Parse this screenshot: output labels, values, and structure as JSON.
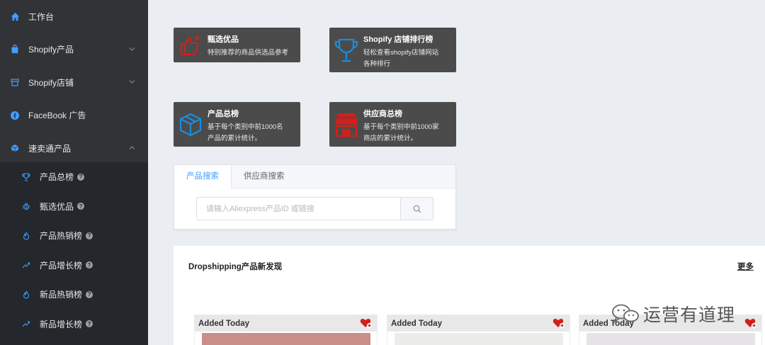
{
  "sidebar": {
    "items": [
      {
        "label": "工作台",
        "icon": "home-icon"
      },
      {
        "label": "Shopify产品",
        "icon": "bag-icon"
      },
      {
        "label": "Shopify店铺",
        "icon": "store-icon"
      },
      {
        "label": "FaceBook 广告",
        "icon": "facebook-icon"
      },
      {
        "label": "速卖通产品",
        "icon": "box-icon"
      }
    ],
    "submenu": [
      {
        "label": "产品总榜",
        "icon": "trophy-icon"
      },
      {
        "label": "甄选优品",
        "icon": "bug-icon"
      },
      {
        "label": "产品热销榜",
        "icon": "fire-icon"
      },
      {
        "label": "产品增长榜",
        "icon": "trend-icon"
      },
      {
        "label": "新品热销榜",
        "icon": "fire-icon"
      },
      {
        "label": "新品增长榜",
        "icon": "trend-icon"
      }
    ]
  },
  "cards": [
    {
      "title": "甄选优品",
      "desc1": "特别推荐的商品供选品参考",
      "desc2": "",
      "icon": "thumbs-up-icon",
      "color": "#d0201c"
    },
    {
      "title": "Shopify 店铺排行榜",
      "desc1": "轻松查看shopify店铺网站",
      "desc2": "各种排行",
      "icon": "trophy-icon",
      "color": "#1a8ddd"
    },
    {
      "title": "产品总榜",
      "desc1": "基于每个类别中前1000名",
      "desc2": "产品的累计统计。",
      "icon": "cube-icon",
      "color": "#1a8ddd"
    },
    {
      "title": "供应商总榜",
      "desc1": "基于每个类别中前1000家",
      "desc2": "商店的累计统计。",
      "icon": "shop-icon",
      "color": "#d0201c"
    }
  ],
  "search": {
    "tabs": [
      "产品搜索",
      "供应商搜索"
    ],
    "placeholder": "请输入Aliexpress产品ID 或链接"
  },
  "discover": {
    "title": "Dropshipping产品新发现",
    "more": "更多",
    "products": [
      {
        "label": "Added Today"
      },
      {
        "label": "Added Today"
      },
      {
        "label": "Added Today"
      }
    ]
  },
  "watermark": {
    "text": "运营有道理"
  },
  "colors": {
    "sidebar": "#313336",
    "submenu": "#24272b",
    "accent": "#409eff",
    "card": "#4b4b4b",
    "red": "#d0201c",
    "blue": "#1a8ddd"
  }
}
